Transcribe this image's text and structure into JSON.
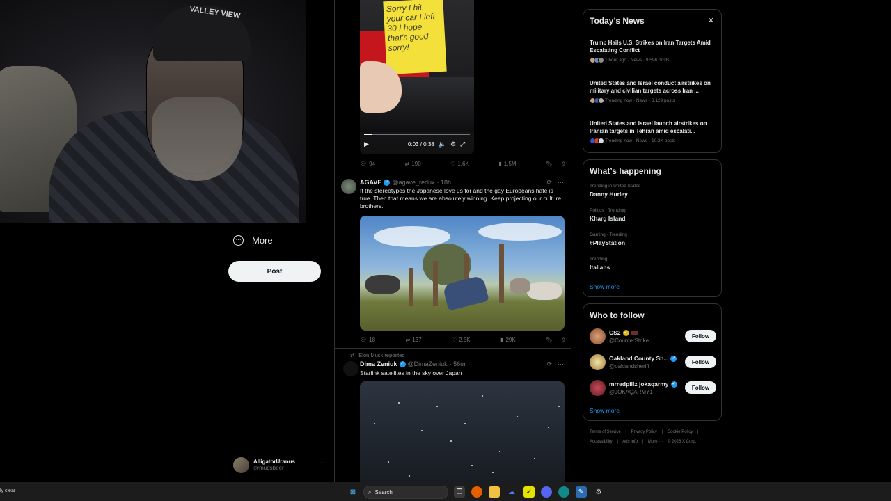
{
  "left_nav": {
    "more_label": "More",
    "post_label": "Post",
    "account": {
      "name": "AlligatorUranus",
      "handle": "@mudsbeer"
    }
  },
  "webcam": {
    "cap_text": "VALLEY VIEW"
  },
  "timeline": {
    "video_post": {
      "note_text": "Sorry I hit your car I left 30 I hope that's good sorry!",
      "video_time": "0:03 / 0:38",
      "progress": 0.08,
      "actions": {
        "replies": "94",
        "reposts": "190",
        "likes": "1.6K",
        "views": "1.5M"
      }
    },
    "tweet1": {
      "name": "AGAVE",
      "handle": "@agave_redux",
      "time": "· 18h",
      "text": "If the stereotypes the Japanese love us for and the gay Europeans hate is true. Then that means we are absolutely winning. Keep projecting our culture brothers.",
      "actions": {
        "replies": "18",
        "reposts": "137",
        "likes": "2.5K",
        "views": "29K"
      }
    },
    "tweet2": {
      "repost_note": "Elon Musk reposted",
      "name": "Dima Zeniuk",
      "handle": "@DimaZeniuk",
      "time": "· 56m",
      "text": "Starlink satellites in the sky over Japan"
    }
  },
  "sidebar": {
    "todays_news": {
      "title": "Today’s News",
      "items": [
        {
          "title": "Trump Hails U.S. Strikes on Iran Targets Amid Escalating Conflict",
          "meta": "1 hour ago · News · 9,596 posts"
        },
        {
          "title": "United States and Israel conduct airstrikes on military and civilian targets across Iran ...",
          "meta": "Trending now · News · 8,129 posts"
        },
        {
          "title": "United States and Israel launch airstrikes on Iranian targets in Tehran amid escalati...",
          "meta": "Trending now · News · 10.2K posts"
        }
      ]
    },
    "whats_happening": {
      "title": "What’s happening",
      "trends": [
        {
          "context": "Trending in United States",
          "name": "Danny Hurley"
        },
        {
          "context": "Politics · Trending",
          "name": "Kharg Island"
        },
        {
          "context": "Gaming · Trending",
          "name": "#PlayStation"
        },
        {
          "context": "Trending",
          "name": "Italians"
        }
      ],
      "show_more": "Show more"
    },
    "who_to_follow": {
      "title": "Who to follow",
      "accounts": [
        {
          "name": "CS2",
          "handle": "@CounterStrike",
          "button": "Follow"
        },
        {
          "name": "Oakland County Sh...",
          "handle": "@oaklandsheriff",
          "button": "Follow"
        },
        {
          "name": "mrredpillz jokaqarmy",
          "handle": "@JOKAQARMY1",
          "button": "Follow"
        }
      ],
      "show_more": "Show more"
    },
    "footer": {
      "links": [
        "Terms of Service",
        "|",
        "Privacy Policy",
        "|",
        "Cookie Policy",
        "|"
      ],
      "links2": [
        "Accessibility",
        "|",
        "Ads info",
        "|",
        "More ···",
        "© 2026 X Corp."
      ]
    }
  },
  "taskbar": {
    "weather": "ly clear",
    "search_label": "Search"
  },
  "colors": {
    "accent": "#1d9bf0",
    "background": "#000000",
    "border": "#2f3336"
  }
}
